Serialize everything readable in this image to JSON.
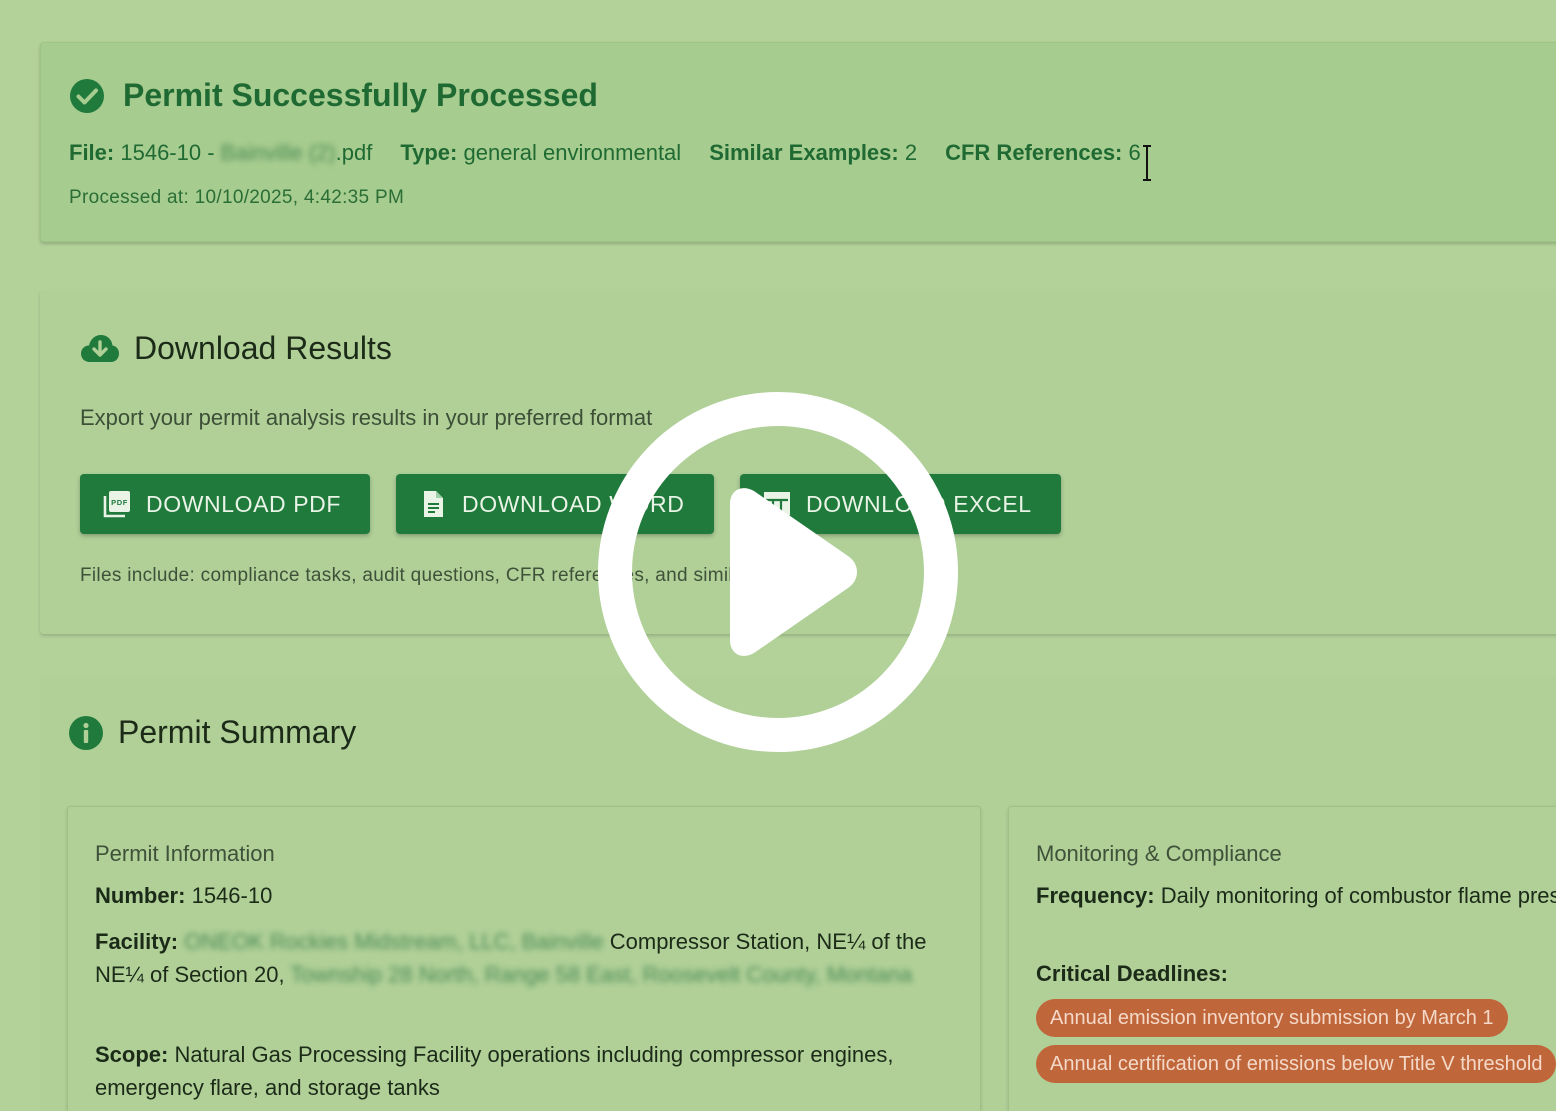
{
  "banner": {
    "title": "Permit Successfully Processed",
    "file_label": "File:",
    "file_prefix": "1546-10 -",
    "file_redacted": "Bainville (2)",
    "file_suffix": ".pdf",
    "type_label": "Type:",
    "type_value": "general environmental",
    "similar_label": "Similar Examples:",
    "similar_value": "2",
    "cfr_label": "CFR References:",
    "cfr_value": "6",
    "processed": "Processed at: 10/10/2025, 4:42:35 PM"
  },
  "download": {
    "title": "Download Results",
    "description": "Export your permit analysis results in your preferred format",
    "buttons": {
      "pdf": "DOWNLOAD PDF",
      "word": "DOWNLOAD WORD",
      "excel": "DOWNLOAD EXCEL"
    },
    "note": "Files include: compliance tasks, audit questions, CFR references, and similar examples"
  },
  "summary": {
    "title": "Permit Summary",
    "permit_info": {
      "title": "Permit Information",
      "number_label": "Number:",
      "number_value": "1546-10",
      "facility_label": "Facility:",
      "facility_redacted_1": "ONEOK Rockies Midstream, LLC, Bainville",
      "facility_text": "Compressor Station, NE¼ of the NE¼ of Section 20,",
      "facility_redacted_2": "Township 28 North, Range 58 East, Roosevelt County, Montana",
      "scope_label": "Scope:",
      "scope_value": "Natural Gas Processing Facility operations including compressor engines, emergency flare, and storage tanks"
    },
    "monitoring": {
      "title": "Monitoring & Compliance",
      "frequency_label": "Frequency:",
      "frequency_value": "Daily monitoring of combustor flame presence and periodic inspections",
      "deadlines_label": "Critical Deadlines:",
      "deadlines": [
        "Annual emission inventory submission by March 1",
        "Annual certification of emissions below Title V threshold"
      ]
    }
  },
  "colors": {
    "page_bg": "#b2d29a",
    "accent_green": "#1f7a3c",
    "title_green": "#1f6a33",
    "chip_orange": "#c0663b"
  }
}
